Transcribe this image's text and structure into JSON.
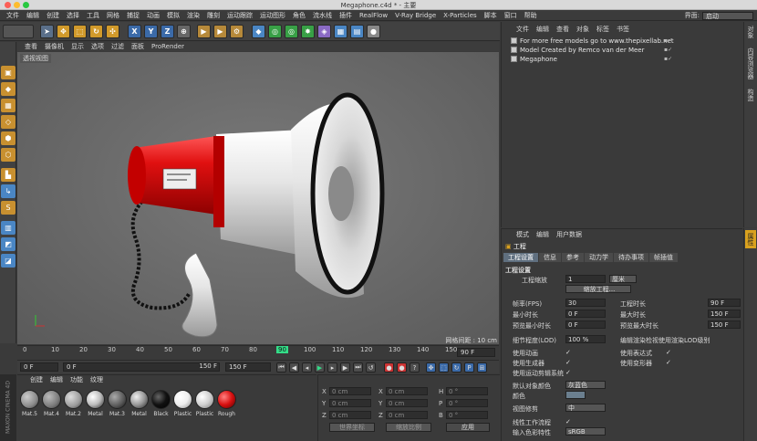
{
  "window": {
    "title": "Megaphone.c4d * - 主要"
  },
  "menubar": [
    "文件",
    "编辑",
    "创建",
    "选择",
    "工具",
    "网格",
    "捕捉",
    "动画",
    "模拟",
    "渲染",
    "雕刻",
    "运动跟踪",
    "运动图形",
    "角色",
    "流水线",
    "插件",
    "RealFlow",
    "V-Ray Bridge",
    "X-Particles",
    "脚本",
    "窗口",
    "帮助"
  ],
  "layout": {
    "label": "界面:",
    "value": "启动"
  },
  "toolbar": {
    "x": "X",
    "y": "Y",
    "z": "Z"
  },
  "viewport": {
    "menu": [
      "查看",
      "摄像机",
      "显示",
      "选项",
      "过滤",
      "面板",
      "ProRender"
    ],
    "label": "透视视图",
    "grid_info": "网格间距 : 10 cm"
  },
  "timeline": {
    "ticks": [
      "0",
      "10",
      "20",
      "30",
      "40",
      "50",
      "60",
      "70",
      "80",
      "90",
      "100",
      "110",
      "120",
      "130",
      "140",
      "150"
    ],
    "current": "90",
    "end_field": "90 F"
  },
  "playbar": {
    "start": "0 F",
    "start2": "0 F",
    "end1": "150 F",
    "end2": "150 F"
  },
  "materials": {
    "menu": [
      "创建",
      "编辑",
      "功能",
      "纹理"
    ],
    "items": [
      {
        "label": "Mat.5",
        "color": "#8a8a8a"
      },
      {
        "label": "Mat.4",
        "color": "#7a7a7a"
      },
      {
        "label": "Mat.2",
        "color": "#9a9a9a"
      },
      {
        "label": "Metal",
        "color": "#bdbdbd"
      },
      {
        "label": "Mat.3",
        "color": "#555555"
      },
      {
        "label": "Metal",
        "color": "#999999"
      },
      {
        "label": "Black",
        "color": "#111111"
      },
      {
        "label": "Plastic",
        "color": "#eeeeee"
      },
      {
        "label": "Plastic",
        "color": "#d0d0d0"
      },
      {
        "label": "Rough",
        "color": "#d81010"
      }
    ],
    "brand": "MAXON CINEMA 4D"
  },
  "coords": {
    "rows": [
      {
        "a": "X",
        "av": "0 cm",
        "b": "X",
        "bv": "0 cm",
        "c": "H",
        "cv": "0 °"
      },
      {
        "a": "Y",
        "av": "0 cm",
        "b": "Y",
        "bv": "0 cm",
        "c": "P",
        "cv": "0 °"
      },
      {
        "a": "Z",
        "av": "0 cm",
        "b": "Z",
        "bv": "0 cm",
        "c": "B",
        "cv": "0 °"
      }
    ],
    "mode1": "世界坐标",
    "mode2": "缩放比例",
    "apply": "应用"
  },
  "objects": {
    "menu": [
      "文件",
      "编辑",
      "查看",
      "对象",
      "标签",
      "书签"
    ],
    "items": [
      "For more free models go to www.thepixellab.net",
      "Model Created by Remco van der Meer",
      "Megaphone"
    ]
  },
  "right_tabs_top": [
    "对象",
    "内容浏览器",
    "构造"
  ],
  "right_tabs_bottom": [
    "属性"
  ],
  "attributes": {
    "menu": [
      "模式",
      "编辑",
      "用户数据"
    ],
    "title": "工程",
    "tabs": [
      "工程设置",
      "信息",
      "参考",
      "动力学",
      "待办事项",
      "帧插值"
    ],
    "section": "工程设置",
    "scale_label": "工程缩放",
    "scale_value": "1",
    "scale_unit": "厘米",
    "scale_button": "缩放工程...",
    "fps_label": "帧率(FPS)",
    "fps_value": "30",
    "duration_label": "工程时长",
    "duration_value": "90 F",
    "min_label": "最小时长",
    "min_value": "0 F",
    "max_label": "最大时长",
    "max_value": "150 F",
    "pmin_label": "预览最小时长",
    "pmin_value": "0 F",
    "pmax_label": "预览最大时长",
    "pmax_value": "150 F",
    "lod_label": "细节程度(LOD)",
    "lod_value": "100 %",
    "lod_render": "编辑渲染检视使用渲染LOD级别",
    "anim_label": "使用动画",
    "expr_label": "使用表达式",
    "gen_label": "使用生成器",
    "deform_label": "使用变形器",
    "motion_label": "使用运动剪辑系统",
    "objcolor_label": "默认对象颜色",
    "objcolor_value": "灰蓝色",
    "color_label": "颜色",
    "view_label": "视图修剪",
    "view_value": "中",
    "linear_label": "线性工作流程",
    "input_label": "输入色彩特性",
    "input_value": "sRGB"
  }
}
